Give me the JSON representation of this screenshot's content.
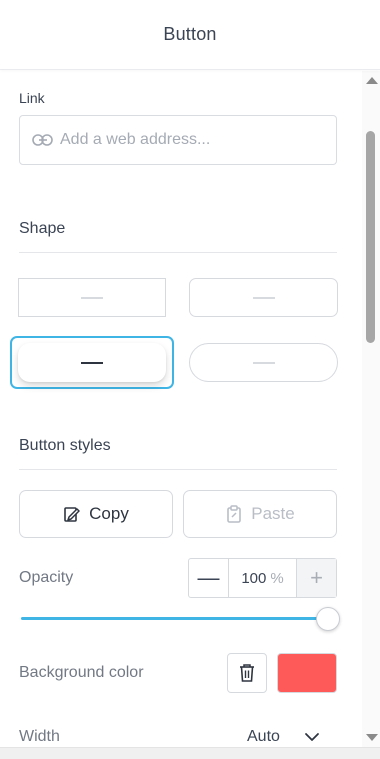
{
  "header": {
    "title": "Button"
  },
  "link": {
    "label": "Link",
    "placeholder": "Add a web address..."
  },
  "shape": {
    "title": "Shape",
    "selected_index": 2
  },
  "button_styles": {
    "title": "Button styles",
    "copy_label": "Copy",
    "paste_label": "Paste"
  },
  "opacity": {
    "label": "Opacity",
    "value": "100",
    "unit": "%",
    "minus": "—",
    "plus": "+"
  },
  "background": {
    "label": "Background color",
    "color": "#ff5a5a"
  },
  "width": {
    "label": "Width",
    "value": "Auto"
  },
  "colors": {
    "accent": "#3fb5e6",
    "text": "#3b4454",
    "muted": "#727984"
  }
}
